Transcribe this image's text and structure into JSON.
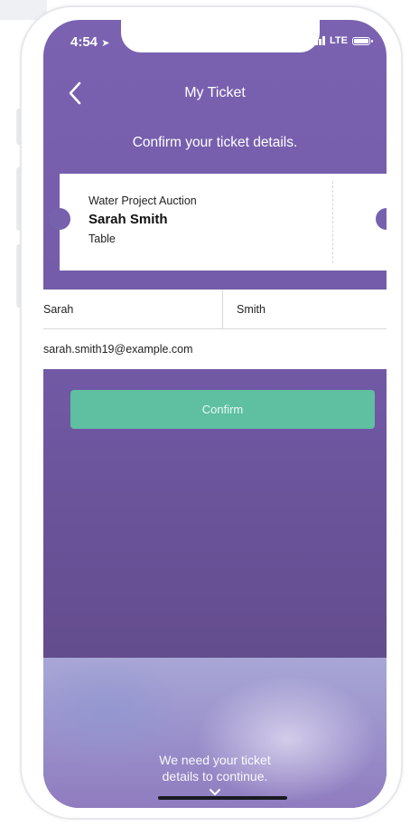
{
  "status_bar": {
    "time": "4:54",
    "network": "LTE"
  },
  "header": {
    "title": "My Ticket",
    "back_icon": "chevron-left-icon"
  },
  "subtitle": "Confirm your ticket details.",
  "ticket": {
    "event": "Water Project Auction",
    "holder_name": "Sarah Smith",
    "ticket_type": "Table"
  },
  "form": {
    "first_name": "Sarah",
    "last_name": "Smith",
    "email": "sarah.smith19@example.com"
  },
  "confirm_button": {
    "label": "Confirm"
  },
  "bottom_message": {
    "line1": "We need your ticket",
    "line2": "details to continue."
  },
  "colors": {
    "primary_purple": "#7a62b1",
    "confirm_green": "#5fbfa1"
  }
}
